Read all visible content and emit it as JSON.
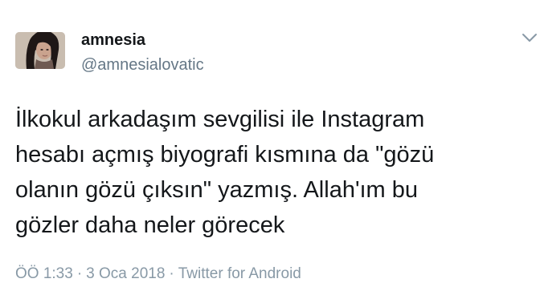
{
  "user": {
    "display_name": "amnesia",
    "handle": "@amnesialovatic"
  },
  "tweet": {
    "text": "İlkokul arkadaşım sevgilisi ile Instagram\nhesabı açmış biyografi kısmına da \"gözü\nolanın gözü çıksın\" yazmış. Allah'ım bu\ngözler daha neler görecek"
  },
  "meta": {
    "time": "ÖÖ 1:33",
    "separator": "·",
    "date": "3 Oca 2018",
    "source": "Twitter for Android"
  },
  "icons": {
    "menu": "chevron-down-icon"
  },
  "colors": {
    "text_primary": "#14171a",
    "text_secondary": "#657786",
    "text_meta": "#8899a6",
    "background": "#ffffff"
  }
}
